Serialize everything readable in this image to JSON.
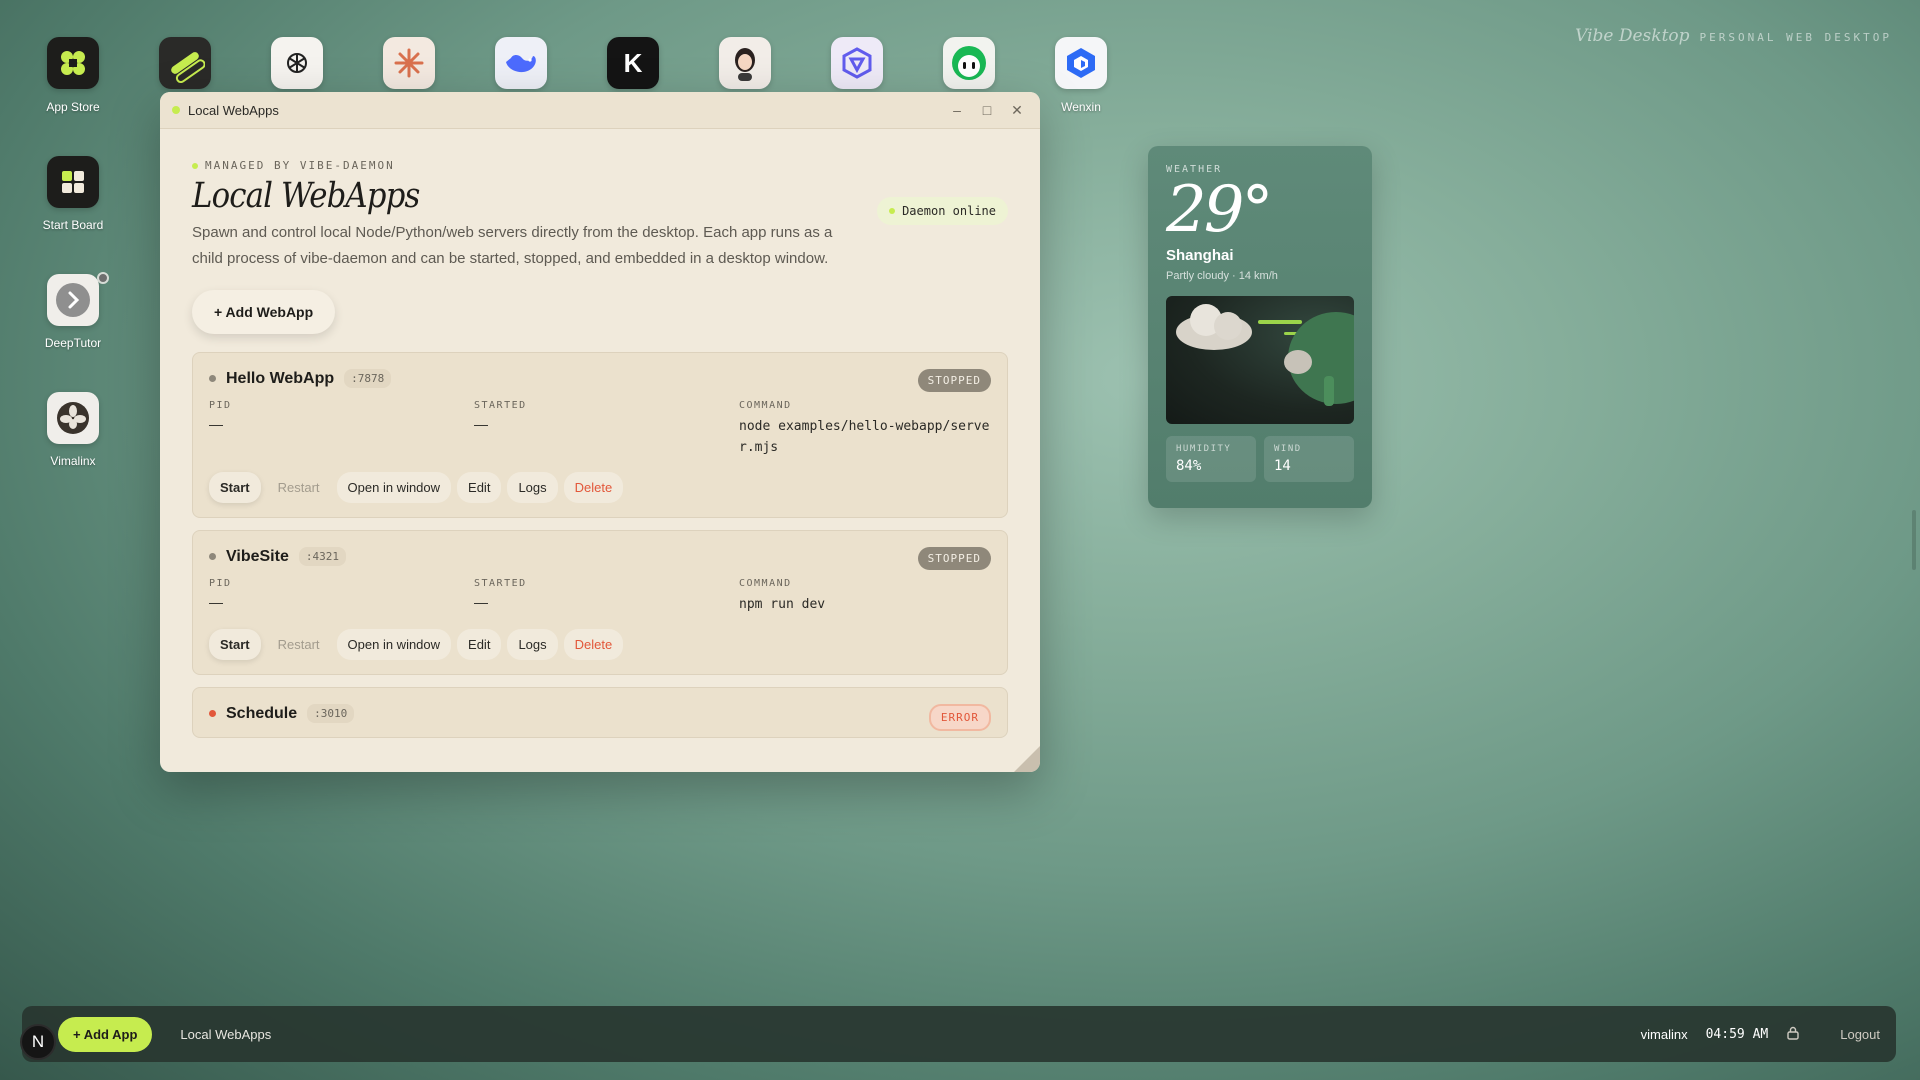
{
  "brand": {
    "name": "Vibe Desktop",
    "tagline": "PERSONAL WEB DESKTOP"
  },
  "dock": [
    {
      "label": "App Store",
      "icon": "app-store-icon"
    },
    {
      "label": "",
      "icon": "link-icon"
    },
    {
      "label": "",
      "icon": "chatgpt-icon"
    },
    {
      "label": "",
      "icon": "claude-icon"
    },
    {
      "label": "",
      "icon": "deepseek-icon"
    },
    {
      "label": "",
      "icon": "kimi-icon"
    },
    {
      "label": "",
      "icon": "avatar-icon"
    },
    {
      "label": "",
      "icon": "qwen-icon"
    },
    {
      "label": "",
      "icon": "robot-icon"
    },
    {
      "label": "Wenxin",
      "icon": "wenxin-icon"
    }
  ],
  "sidebar": [
    {
      "label": "Start Board",
      "icon": "start-board-icon"
    },
    {
      "label": "DeepTutor",
      "icon": "deeptutor-icon"
    },
    {
      "label": "Vimalinx",
      "icon": "vimalinx-icon"
    }
  ],
  "window": {
    "title": "Local WebApps",
    "managed_by": "MANAGED BY VIBE-DAEMON",
    "heading": "Local WebApps",
    "description": "Spawn and control local Node/Python/web servers directly from the desktop. Each app runs as a child process of vibe-daemon and can be started, stopped, and embedded in a desktop window.",
    "daemon_status": "Daemon online",
    "add_button": "+ Add WebApp",
    "labels": {
      "pid": "PID",
      "started": "STARTED",
      "command": "COMMAND"
    },
    "actions": {
      "start": "Start",
      "restart": "Restart",
      "open": "Open in window",
      "edit": "Edit",
      "logs": "Logs",
      "delete": "Delete"
    },
    "apps": [
      {
        "name": "Hello WebApp",
        "port": ":7878",
        "state": "STOPPED",
        "pid": "—",
        "started": "—",
        "command": "node examples/hello-webapp/server.mjs"
      },
      {
        "name": "VibeSite",
        "port": ":4321",
        "state": "STOPPED",
        "pid": "—",
        "started": "—",
        "command": "npm run dev"
      },
      {
        "name": "Schedule",
        "port": ":3010",
        "state": "ERROR"
      }
    ]
  },
  "weather": {
    "label": "WEATHER",
    "temp": "29°",
    "city": "Shanghai",
    "condition": "Partly cloudy · 14 km/h",
    "humidity_label": "HUMIDITY",
    "humidity": "84%",
    "wind_label": "WIND",
    "wind": "14"
  },
  "taskbar": {
    "avatar": "N",
    "add_app": "+ Add App",
    "task": "Local WebApps",
    "user": "vimalinx",
    "time": "04:59 AM",
    "logout": "Logout"
  },
  "colors": {
    "accent": "#c6ec4f",
    "danger": "#e2573a",
    "window_bg": "#f1eadc"
  }
}
